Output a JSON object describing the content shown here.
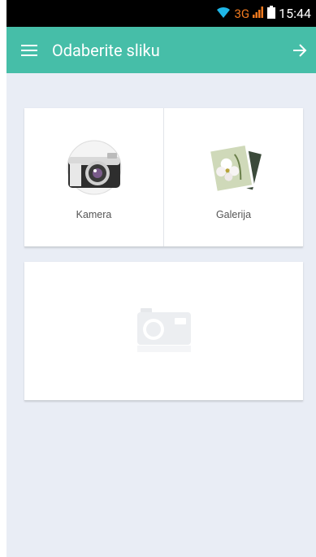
{
  "status_bar": {
    "network": "3G",
    "time": "15:44"
  },
  "app_bar": {
    "title": "Odaberite sliku",
    "menu_icon": "hamburger-menu-icon",
    "next_icon": "arrow-right-icon"
  },
  "source_options": [
    {
      "label": "Kamera",
      "icon": "camera-icon"
    },
    {
      "label": "Galerija",
      "icon": "gallery-photos-icon"
    }
  ],
  "preview": {
    "icon": "camera-placeholder-icon"
  },
  "colors": {
    "accent": "#46bea8",
    "background": "#e9edf5",
    "status_bar": "#000000"
  }
}
